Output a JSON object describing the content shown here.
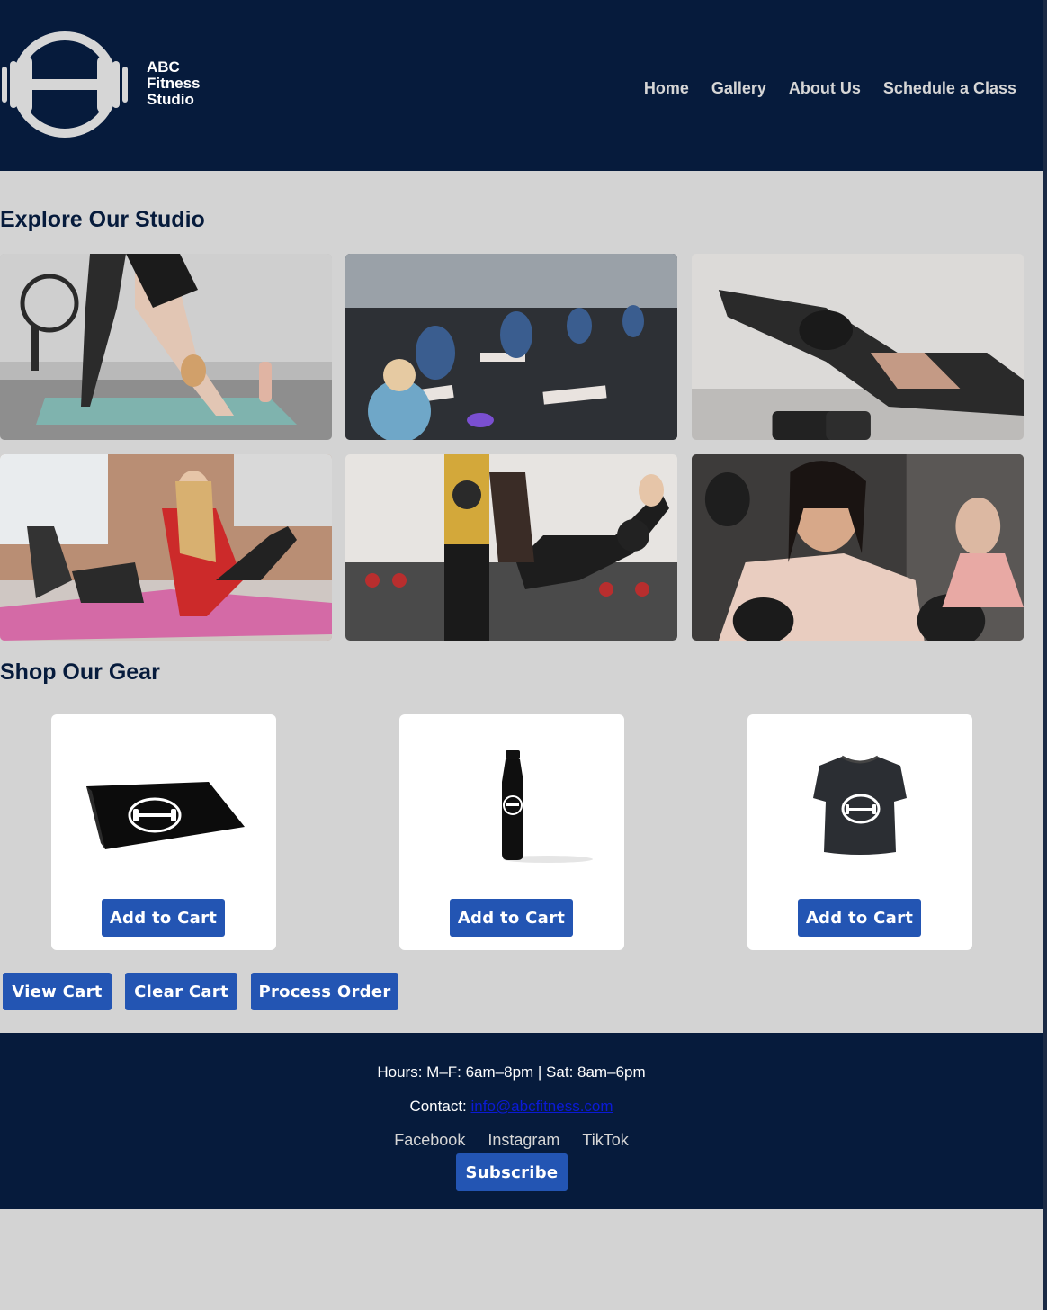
{
  "brand": {
    "name_line1": "ABC",
    "name_line2": "Fitness",
    "name_line3": "Studio"
  },
  "nav": {
    "items": [
      "Home",
      "Gallery",
      "About Us",
      "Schedule a Class"
    ]
  },
  "gallery": {
    "title": "Explore Our Studio"
  },
  "shop": {
    "title": "Shop Our Gear",
    "products": [
      {
        "item": "yoga mat",
        "button_label": "Add to Cart"
      },
      {
        "item": "water bottle",
        "button_label": "Add to Cart"
      },
      {
        "item": "t-shirt",
        "button_label": "Add to Cart"
      }
    ],
    "actions": {
      "view_cart": "View Cart",
      "clear_cart": "Clear Cart",
      "process_order": "Process Order"
    }
  },
  "footer": {
    "hours": "Hours: M–F: 6am–8pm | Sat: 8am–6pm",
    "contact_label": "Contact:",
    "contact_email": "info@abcfitness.com",
    "socials": [
      "Facebook",
      "Instagram",
      "TikTok"
    ],
    "subscribe_label": "Subscribe"
  },
  "colors": {
    "header_bg": "#061b3c",
    "page_bg": "#d3d3d3",
    "button": "#2355b3",
    "nav_text": "#d6d6d6"
  }
}
